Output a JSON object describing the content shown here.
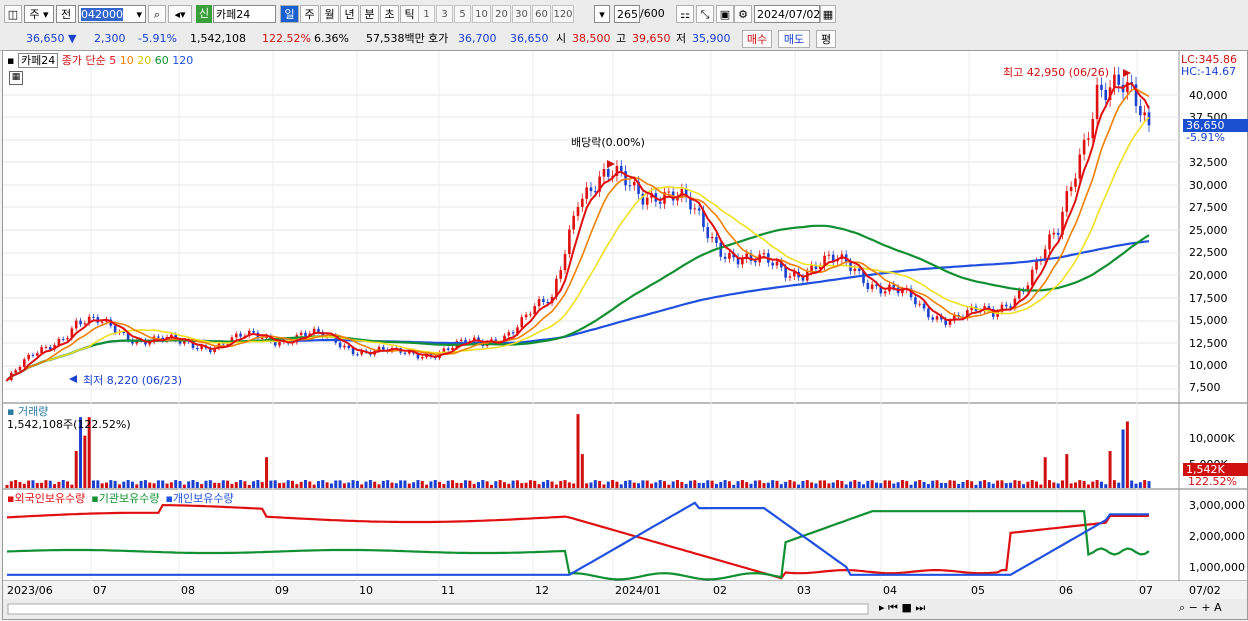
{
  "toolbar": {
    "market": "주",
    "prev": "전",
    "code": "042000",
    "badge": "신",
    "name": "카페24",
    "periods": [
      "일",
      "주",
      "월",
      "년",
      "분",
      "초",
      "틱"
    ],
    "periods_active": "일",
    "nums": [
      "1",
      "3",
      "5",
      "10",
      "20",
      "30",
      "60",
      "120"
    ],
    "count": "265",
    "count_total": "/600",
    "date": "2024/07/02"
  },
  "quote": {
    "price": "36,650",
    "arrow": "▼",
    "change": "2,300",
    "change_pct": "-5.91%",
    "volume": "1,542,108",
    "vol_ratio": "122.52%",
    "turnover": "6.36%",
    "amount": "57,538백만",
    "bid_label": "호가",
    "bid1": "36,700",
    "bid2": "36,650",
    "open_label": "시",
    "open": "38,500",
    "high_label": "고",
    "high": "39,650",
    "low_label": "저",
    "low": "35,900",
    "buy": "매수",
    "sell": "매도",
    "eval": "평"
  },
  "chart": {
    "legend_name": "카페24",
    "legend_ma_title": "종가 단순",
    "ma_periods": [
      "5",
      "10",
      "20",
      "60",
      "120"
    ],
    "ma_colors": [
      "#e01010",
      "#f08000",
      "#f0e020",
      "#109030",
      "#2050e0"
    ],
    "lc": "LC:345.86",
    "hc": "HC:-14.67",
    "high_mark": "최고 42,950 (06/26)",
    "low_mark": "최저 8,220 (06/23)",
    "dividend": "배당락(0.00%)",
    "price_tag": "36,650",
    "pct_tag": "-5.91%",
    "volume_title": "거래량",
    "volume_value": "1,542,108주(122.52%)",
    "vol_tag": "1,542K",
    "vol_pct_tag": "122.52%",
    "holdings": [
      "외국인보유수량",
      "기관보유수량",
      "개인보유수량"
    ],
    "holdings_colors": [
      "#e01010",
      "#109030",
      "#2050e0"
    ],
    "x_labels": [
      "2023/06",
      "07",
      "08",
      "09",
      "10",
      "11",
      "12",
      "2024/01",
      "02",
      "03",
      "04",
      "05",
      "06",
      "07"
    ],
    "x_end_label": "07/02"
  },
  "chart_data": {
    "type": "candlestick",
    "price_axis": [
      "40,000",
      "37,500",
      "32,500",
      "30,000",
      "27,500",
      "25,000",
      "22,500",
      "20,000",
      "17,500",
      "15,000",
      "12,500",
      "10,000",
      "7,500"
    ],
    "volume_axis": [
      "10,000K",
      "5,000K"
    ],
    "holdings_axis": [
      "3,000,000",
      "2,000,000",
      "1,000,000"
    ],
    "close_series": [
      [
        "2023/06",
        8.5
      ],
      [
        "2023/07",
        15
      ],
      [
        "2023/08",
        12.3
      ],
      [
        "2023/09",
        13.5
      ],
      [
        "2023/10",
        11.2
      ],
      [
        "2023/11",
        12.5
      ],
      [
        "2023/12",
        17
      ],
      [
        "2023/12",
        30
      ],
      [
        "2024/01",
        30
      ],
      [
        "2024/02",
        21
      ],
      [
        "2024/03",
        21
      ],
      [
        "2024/04",
        16
      ],
      [
        "2024/05",
        15.5
      ],
      [
        "2024/06",
        24
      ],
      [
        "2024/06",
        42
      ],
      [
        "2024/07",
        36.65
      ]
    ]
  }
}
